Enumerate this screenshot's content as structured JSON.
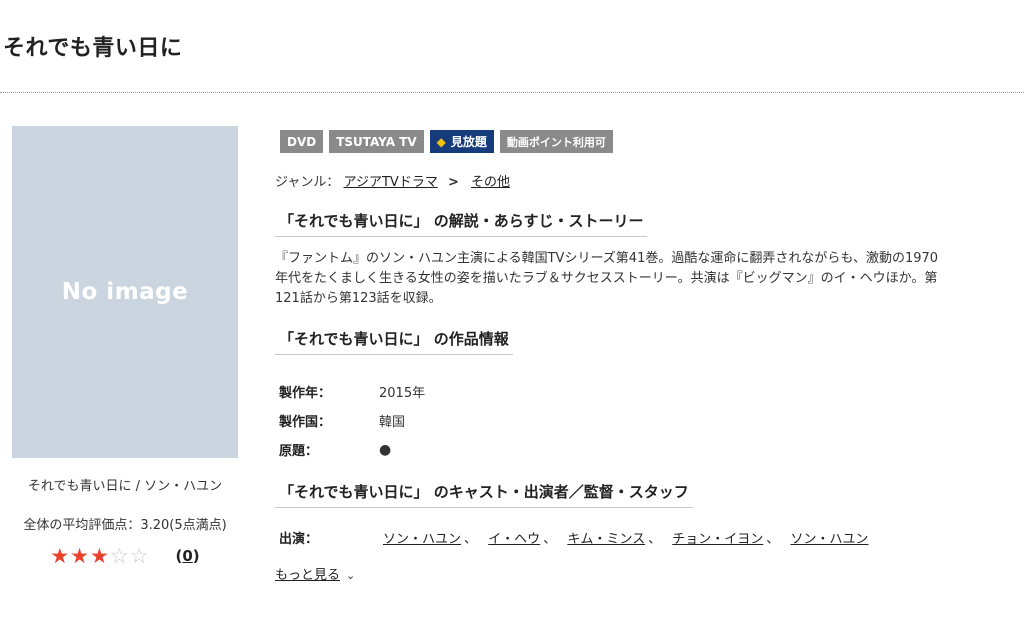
{
  "title": "それでも青い日に",
  "image": {
    "placeholder_text": "No image"
  },
  "caption": "それでも青い日に / ソン・ハユン",
  "rating": {
    "label": "全体の平均評価点：3.20(5点満点)",
    "value": 3.2,
    "max": 5,
    "count": "0"
  },
  "badges": [
    "DVD",
    "TSUTAYA TV",
    "見放題",
    "動画ポイント利用可"
  ],
  "genre": {
    "label": "ジャンル：",
    "primary": "アジアTVドラマ",
    "separator": ">",
    "secondary": "その他"
  },
  "synopsis": {
    "heading": "「それでも青い日に」 の解説・あらすじ・ストーリー",
    "line1": "『ファントム』のソン・ハユン主演による韓国TVシリーズ第41巻。過酷な運命に翻弄されながらも、激動の1970",
    "line2": "年代をたくましく生きる女性の姿を描いたラブ＆サクセスストーリー。共演は『ビッグマン』のイ・ヘウほか。第",
    "line3": "121話から第123話を収録。"
  },
  "info": {
    "heading": "「それでも青い日に」 の作品情報",
    "rows": [
      {
        "label": "製作年：",
        "value": "2015年"
      },
      {
        "label": "製作国：",
        "value": "韓国"
      },
      {
        "label": "原題：",
        "value": "●"
      }
    ]
  },
  "cast": {
    "heading": "「それでも青い日に」 のキャスト・出演者／監督・スタッフ",
    "label": "出演：",
    "names": [
      "ソン・ハユン",
      "イ・ヘウ",
      "キム・ミンス",
      "チョン・イヨン",
      "ソン・ハユン"
    ],
    "separator": "、",
    "more_label": "もっと見る"
  },
  "colors": {
    "star": "#e8432e",
    "badge_gray": "#8a8a8a",
    "badge_navy": "#163c7c",
    "placeholder_bg": "#cbd5df"
  }
}
